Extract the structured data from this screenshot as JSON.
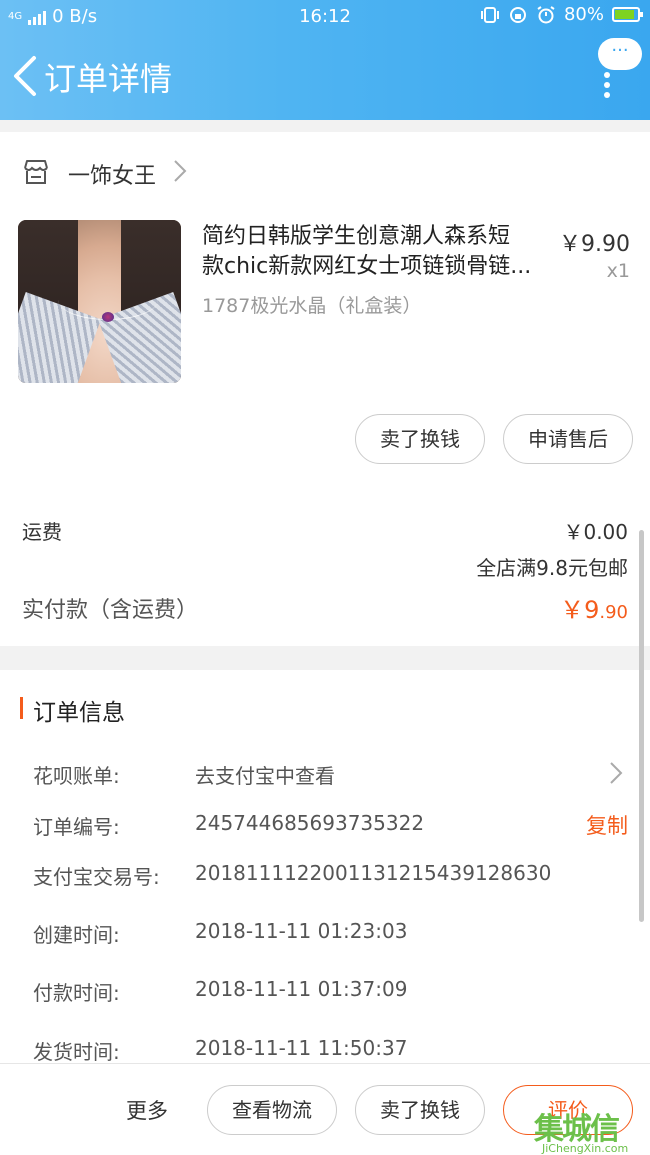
{
  "status_bar": {
    "network_type": "4G",
    "speed": "0 B/s",
    "time": "16:12",
    "battery": "80%",
    "battery_level": 0.8
  },
  "nav": {
    "title": "订单详情",
    "more_bubble": "···"
  },
  "shop": {
    "name": "一饰女王"
  },
  "product": {
    "title_line1": "简约日韩版学生创意潮人森系短",
    "title_line2": "款chic新款网红女士项链锁骨链...",
    "sku": "1787极光水晶（礼盒装）",
    "price": "￥9.90",
    "quantity": "x1",
    "actions": {
      "resell": "卖了换钱",
      "after_sales": "申请售后"
    }
  },
  "fees": {
    "shipping_label": "运费",
    "shipping_value": "￥0.00",
    "shipping_note": "全店满9.8元包邮",
    "paid_label": "实付款（含运费）",
    "paid_currency_int": "￥9",
    "paid_decimal": ".90"
  },
  "order_info": {
    "title": "订单信息",
    "rows": [
      {
        "label": "花呗账单:",
        "value": "去支付宝中查看"
      },
      {
        "label": "订单编号:",
        "value": "245744685693735322"
      },
      {
        "label": "支付宝交易号:",
        "value": "2018111122001131215439128630"
      },
      {
        "label": "创建时间:",
        "value": "2018-11-11 01:23:03"
      },
      {
        "label": "付款时间:",
        "value": "2018-11-11 01:37:09"
      },
      {
        "label": "发货时间:",
        "value": "2018-11-11 11:50:37"
      }
    ],
    "copy_label": "复制"
  },
  "bottom_bar": {
    "more": "更多",
    "logistics": "查看物流",
    "resell": "卖了换钱",
    "review": "评价"
  },
  "watermark": {
    "logo": "集城信",
    "url": "JiChengXin.com"
  },
  "colors": {
    "accent": "#f45c1c",
    "header_start": "#6cc0f4",
    "header_end": "#3aa7ef"
  }
}
